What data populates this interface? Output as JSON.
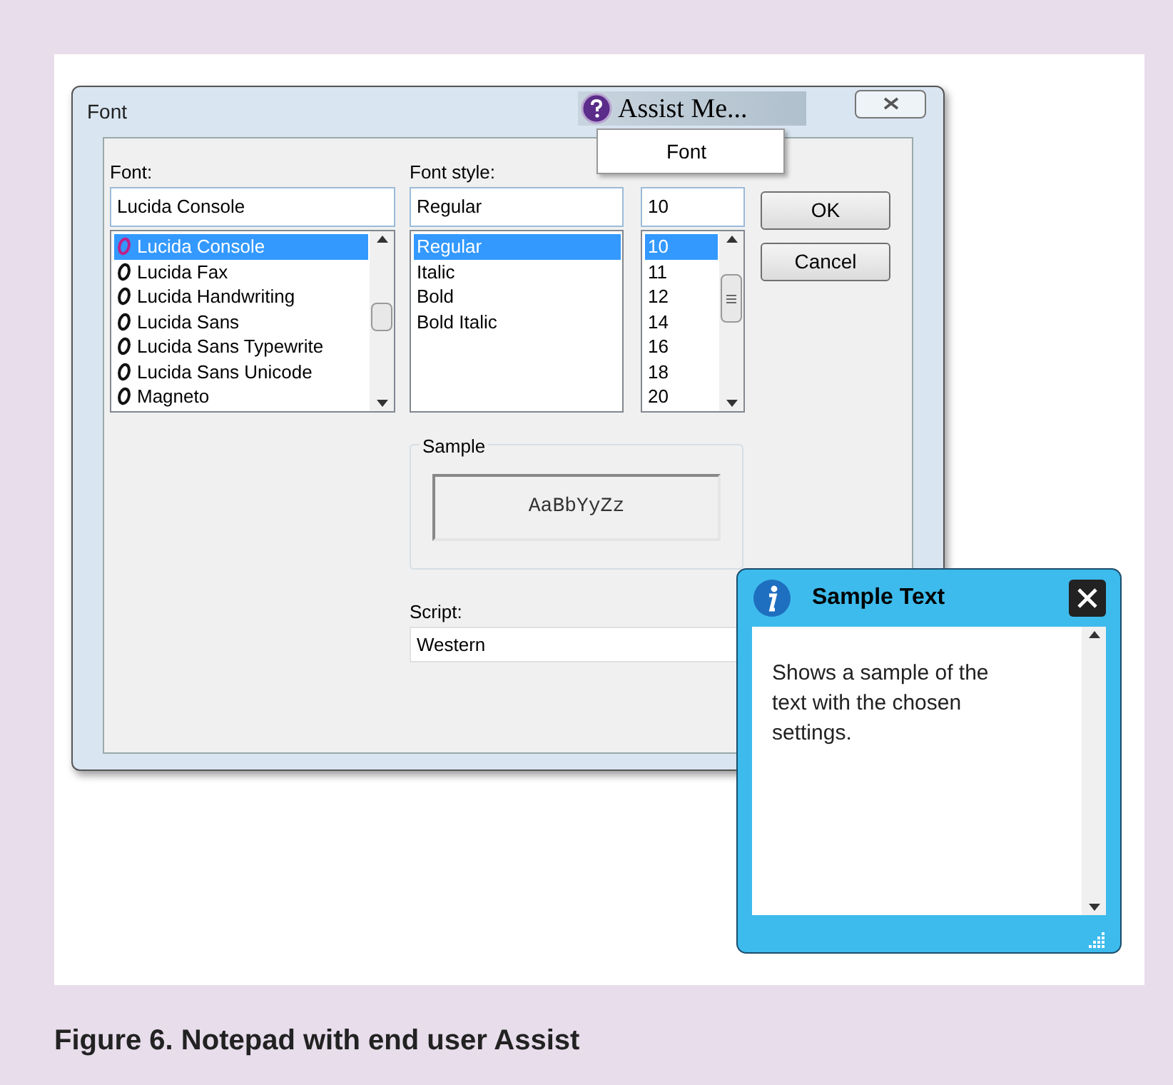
{
  "window": {
    "title": "Font"
  },
  "assist": {
    "label": "Assist Me...",
    "menu": [
      {
        "label": "Font"
      }
    ]
  },
  "font": {
    "label": "Font:",
    "value": "Lucida Console",
    "items": [
      {
        "label": "Lucida Console",
        "selected": true
      },
      {
        "label": "Lucida Fax",
        "selected": false
      },
      {
        "label": "Lucida Handwriting",
        "selected": false
      },
      {
        "label": "Lucida Sans",
        "selected": false
      },
      {
        "label": "Lucida Sans Typewrite",
        "selected": false
      },
      {
        "label": "Lucida Sans Unicode",
        "selected": false
      },
      {
        "label": "Magneto",
        "selected": false
      }
    ]
  },
  "font_style": {
    "label": "Font style:",
    "value": "Regular",
    "items": [
      {
        "label": "Regular",
        "selected": true
      },
      {
        "label": "Italic",
        "selected": false
      },
      {
        "label": "Bold",
        "selected": false
      },
      {
        "label": "Bold Italic",
        "selected": false
      }
    ]
  },
  "size": {
    "value": "10",
    "items": [
      {
        "label": "10",
        "selected": true
      },
      {
        "label": "11",
        "selected": false
      },
      {
        "label": "12",
        "selected": false
      },
      {
        "label": "14",
        "selected": false
      },
      {
        "label": "16",
        "selected": false
      },
      {
        "label": "18",
        "selected": false
      },
      {
        "label": "20",
        "selected": false
      }
    ]
  },
  "buttons": [
    "OK",
    "Cancel"
  ],
  "sample": {
    "label": "Sample",
    "preview": "AaBbYyZz"
  },
  "script": {
    "label": "Script:",
    "value": "Western"
  },
  "help_popup": {
    "title": "Sample Text",
    "body": "Shows a sample of the text with the chosen settings."
  },
  "caption": "Figure 6. Notepad with end user Assist"
}
